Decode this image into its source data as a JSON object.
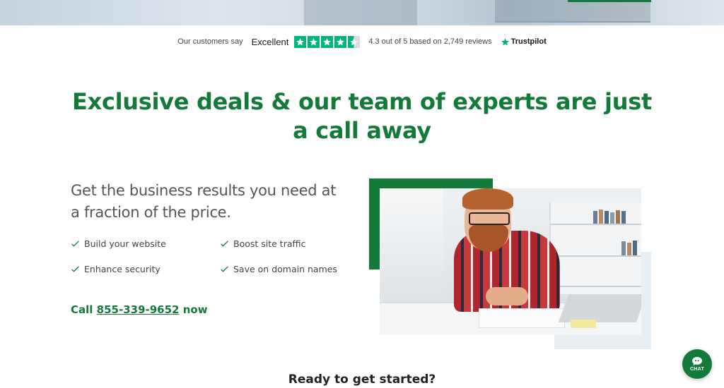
{
  "colors": {
    "brand_green": "#137a3a",
    "trustpilot_green": "#00b67a"
  },
  "trustpilot": {
    "intro": "Our customers say",
    "rating_word": "Excellent",
    "stars_filled": 4.3,
    "summary": "4.3 out of 5 based on 2,749 reviews",
    "brand": "Trustpilot"
  },
  "main": {
    "headline": "Exclusive deals & our team of experts are just a call away",
    "subhead": "Get the business results you need at a fraction of the price.",
    "features": [
      {
        "label": "Build your website",
        "icon": "check-icon"
      },
      {
        "label": "Boost site traffic",
        "icon": "check-icon"
      },
      {
        "label": "Enhance security",
        "icon": "check-icon"
      },
      {
        "label": "Save on domain names",
        "icon": "check-icon"
      }
    ],
    "call": {
      "prefix": "Call",
      "phone": "855-339-9652",
      "suffix": "now"
    }
  },
  "footer_section": {
    "heading": "Ready to get started?"
  },
  "chat_widget": {
    "label": "CHAT",
    "icon": "chat-bubble-icon"
  }
}
